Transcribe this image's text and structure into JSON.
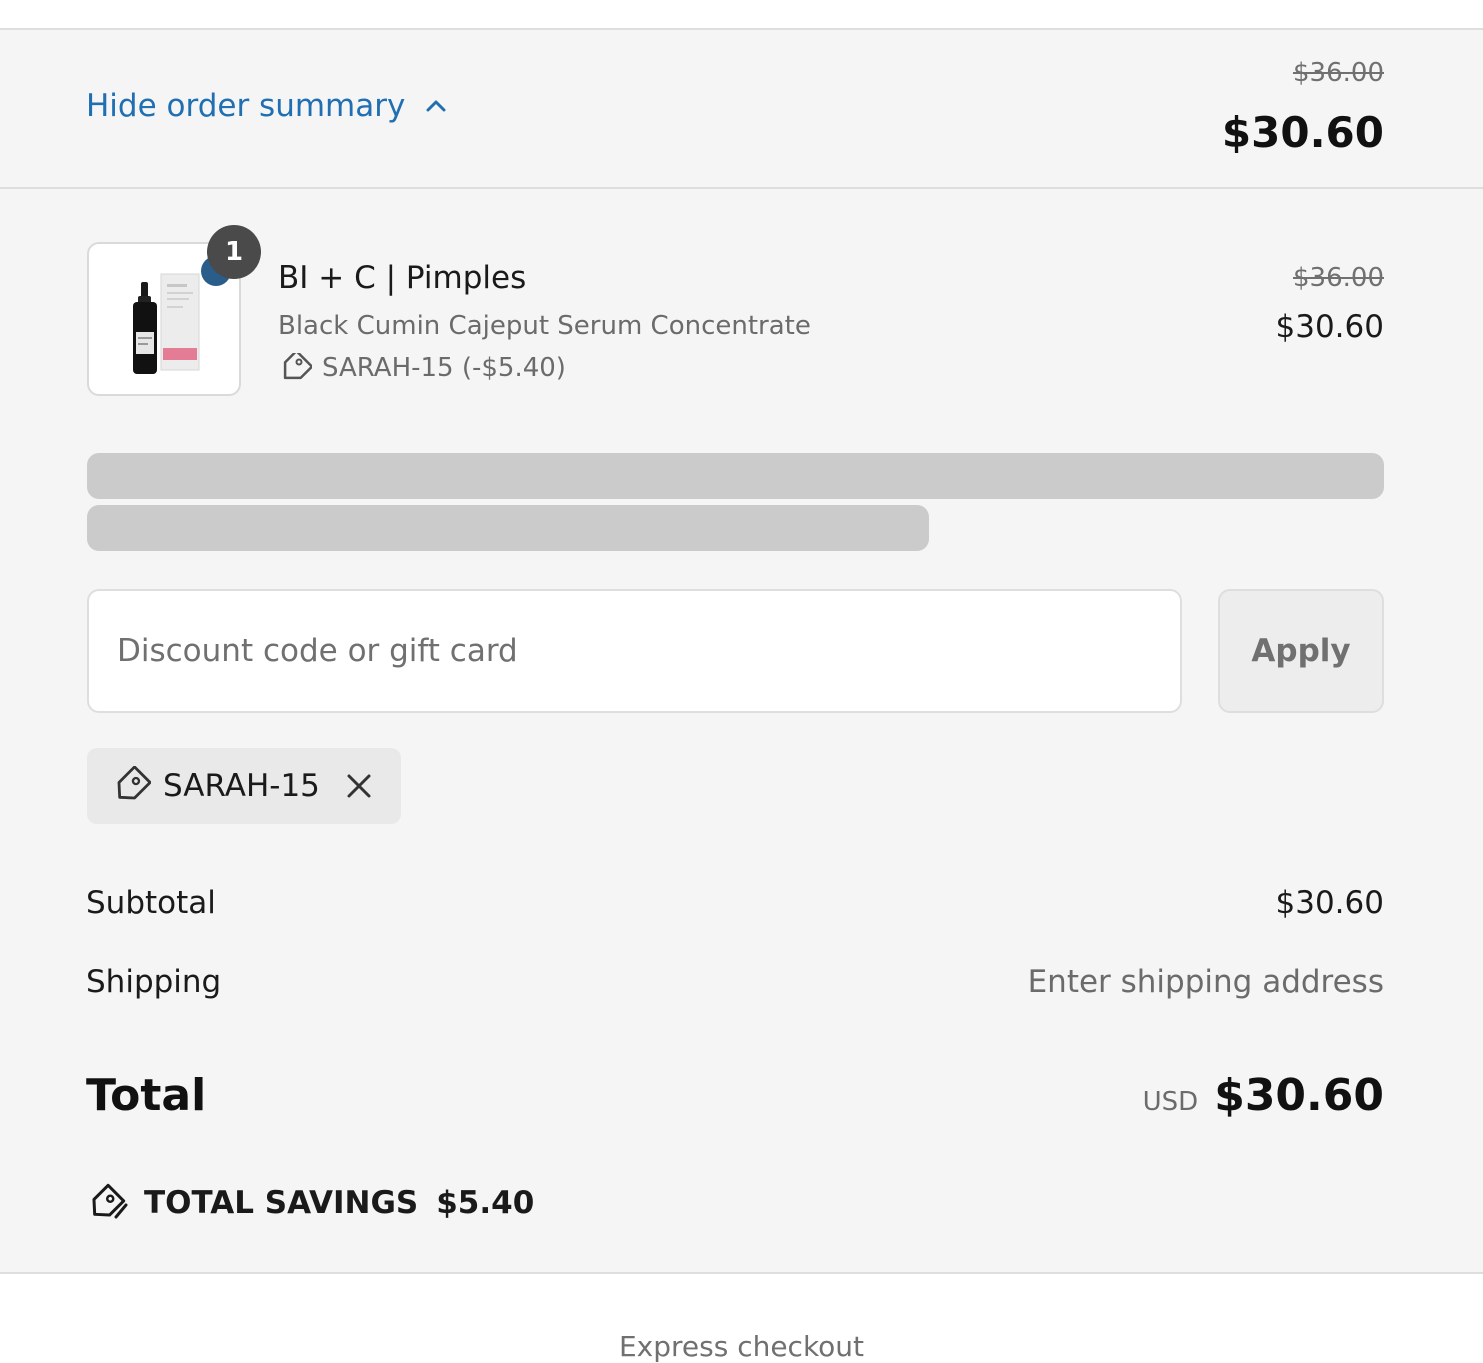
{
  "header": {
    "toggle_label": "Hide order summary",
    "compare_at_total": "$36.00",
    "total": "$30.60"
  },
  "line_item": {
    "quantity": "1",
    "title": "BI + C | Pimples",
    "variant": "Black Cumin Cajeput Serum Concentrate",
    "discount": "SARAH-15 (-$5.40)",
    "compare_at_price": "$36.00",
    "price": "$30.60"
  },
  "discount_form": {
    "placeholder": "Discount code or gift card",
    "value": "",
    "apply_label": "Apply"
  },
  "applied_code": {
    "code": "SARAH-15"
  },
  "costs": {
    "subtotal_label": "Subtotal",
    "subtotal_value": "$30.60",
    "shipping_label": "Shipping",
    "shipping_value": "Enter shipping address",
    "total_label": "Total",
    "currency": "USD",
    "total_value": "$30.60"
  },
  "savings": {
    "label": "TOTAL SAVINGS",
    "amount": "$5.40"
  },
  "express": {
    "label": "Express checkout"
  },
  "colors": {
    "link": "#1f6fb2",
    "panel_bg": "#f5f5f5",
    "skeleton": "#cbcbcb",
    "badge": "#4a4a4a"
  }
}
